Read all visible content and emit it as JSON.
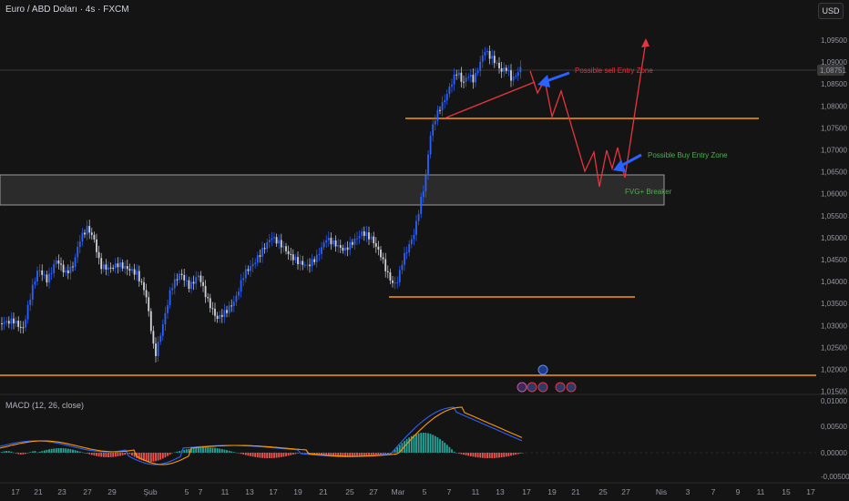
{
  "chart": {
    "title": "Euro / ABD Doları · 4s · FXCM",
    "currency": "USD",
    "price_badge": "1,08751",
    "y_ticks": [
      "1,09500",
      "1,09000",
      "1,08500",
      "1,08000",
      "1,07500",
      "1,07000",
      "1,06500",
      "1,06000",
      "1,05500",
      "1,05000",
      "1,04500",
      "1,04000",
      "1,03500",
      "1,03000",
      "1,02500",
      "1,02000",
      "1,01500"
    ],
    "x_ticks": [
      "17",
      "21",
      "23",
      "27",
      "29",
      "Şub",
      "5",
      "7",
      "11",
      "13",
      "17",
      "19",
      "21",
      "25",
      "27",
      "Mar",
      "5",
      "7",
      "11",
      "13",
      "17",
      "19",
      "21",
      "25",
      "27",
      "Nis",
      "3",
      "7",
      "9",
      "11",
      "15",
      "17"
    ],
    "annotations": {
      "sell_zone": "Possible sell Entry Zone",
      "buy_zone": "Possible Buy Entry Zone",
      "fvg": "FVG+ Breaker"
    },
    "colors": {
      "background": "#141414",
      "up_candle": "#2962ff",
      "down_candle": "#d1d4dc",
      "level_line": "#ff9800",
      "projection": "#e8343e",
      "arrow": "#2962ff",
      "sell_text": "#e8343e",
      "buy_text": "#4caf50",
      "fvg_box": "#3a3a3a"
    },
    "event_icons": [
      "flash-icon",
      "flag-icon",
      "flag-icon",
      "flag-icon",
      "flag-icon"
    ]
  },
  "macd": {
    "label": "MACD (12, 26, close)",
    "y_ticks": [
      "0,01000",
      "0,00500",
      "0,00000",
      "-0,00500"
    ]
  }
}
